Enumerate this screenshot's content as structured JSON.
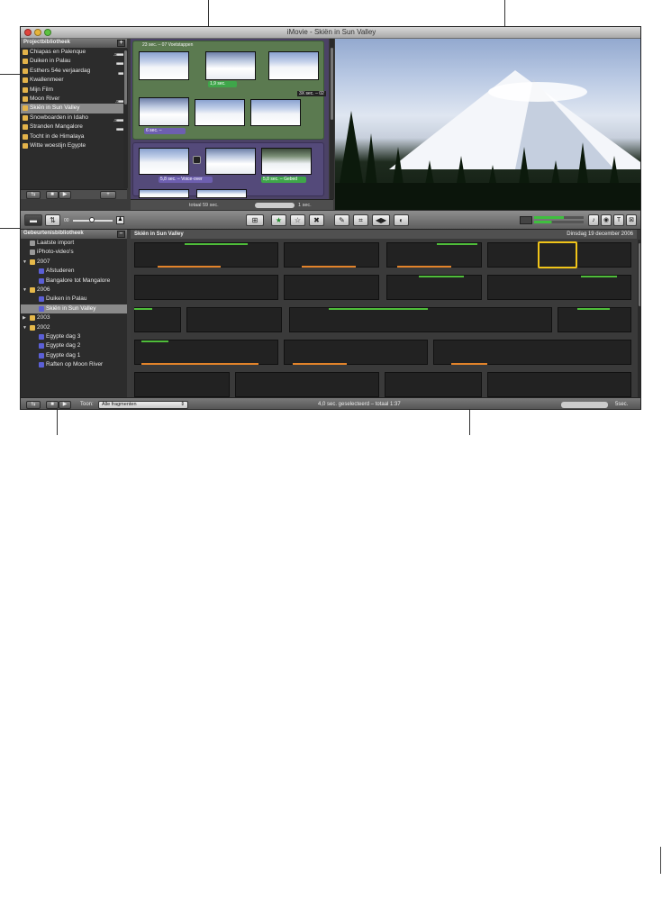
{
  "window": {
    "title": "iMovie - Skiën in Sun Valley"
  },
  "project_library": {
    "header": "Projectbibliotheek",
    "add_label": "+",
    "items": [
      {
        "label": "Chiapas en Palenque",
        "meter": "♫ ■■■■"
      },
      {
        "label": "Duiken in Palau",
        "meter": "■■■■"
      },
      {
        "label": "Esthers 54e verjaardag",
        "meter": "■■■"
      },
      {
        "label": "Kwallenmeer",
        "meter": ""
      },
      {
        "label": "Mijn Film",
        "meter": ""
      },
      {
        "label": "Moon River",
        "meter": "♫ ■■■"
      },
      {
        "label": "Skiën in Sun Valley",
        "meter": ""
      },
      {
        "label": "Snowboarden in Idaho",
        "meter": "♫ ■■■■"
      },
      {
        "label": "Stranden Mangalore",
        "meter": "■■■■"
      },
      {
        "label": "Tocht in de Himalaya",
        "meter": ""
      },
      {
        "label": "Witte woestijn Egypte",
        "meter": ""
      }
    ],
    "selected_index": 6
  },
  "project": {
    "green_group_label": "23 sec. – 07 Voetstappen",
    "caption_1": "1,9 sec.",
    "caption_2": "6 sec. –",
    "tag_right": "3X sec. – 02",
    "caption_3": "5,8 sec. – Voice-over",
    "caption_4": "5,8 sec. – Gebed",
    "total": "totaal 59 sec.",
    "zoom_label": "1 sec."
  },
  "toolbar": {
    "thumb_label": "00"
  },
  "event_library": {
    "header": "Gebeurtenisbibliotheek",
    "items": [
      {
        "label": "Laatste import",
        "level": 0,
        "icon": "gray",
        "arrow": ""
      },
      {
        "label": "iPhoto-video's",
        "level": 0,
        "icon": "gray",
        "arrow": ""
      },
      {
        "label": "2007",
        "level": 0,
        "icon": "yellow",
        "arrow": "▼"
      },
      {
        "label": "Afstuderen",
        "level": 1,
        "icon": "blue",
        "arrow": ""
      },
      {
        "label": "Bangalore tot Mangalore",
        "level": 1,
        "icon": "blue",
        "arrow": ""
      },
      {
        "label": "2006",
        "level": 0,
        "icon": "yellow",
        "arrow": "▼"
      },
      {
        "label": "Duiken in Palau",
        "level": 1,
        "icon": "blue",
        "arrow": ""
      },
      {
        "label": "Skiën in Sun Valley",
        "level": 1,
        "icon": "blue",
        "arrow": ""
      },
      {
        "label": "2003",
        "level": 0,
        "icon": "yellow",
        "arrow": "▶"
      },
      {
        "label": "2002",
        "level": 0,
        "icon": "yellow",
        "arrow": "▼"
      },
      {
        "label": "Egypte dag 3",
        "level": 1,
        "icon": "blue",
        "arrow": ""
      },
      {
        "label": "Egypte dag 2",
        "level": 1,
        "icon": "blue",
        "arrow": ""
      },
      {
        "label": "Egypte dag 1",
        "level": 1,
        "icon": "blue",
        "arrow": ""
      },
      {
        "label": "Raften op Moon River",
        "level": 1,
        "icon": "blue",
        "arrow": ""
      }
    ],
    "selected_index": 7
  },
  "event_browser": {
    "title": "Skiën in Sun Valley",
    "date": "Dinsdag 19 december 2006"
  },
  "bottom_bar": {
    "show_label": "Toon:",
    "filter_value": "Alle fragmenten",
    "status": "4,0 sec. geselecteerd – totaal 1:37",
    "zoom_label": "5sec."
  },
  "colors": {
    "selection_yellow": "#f0c419",
    "green_clip": "#3fa64a",
    "purple_clip": "#6d5fb0",
    "used_orange": "#e2832a",
    "favorite_green": "#4fbd3a"
  }
}
